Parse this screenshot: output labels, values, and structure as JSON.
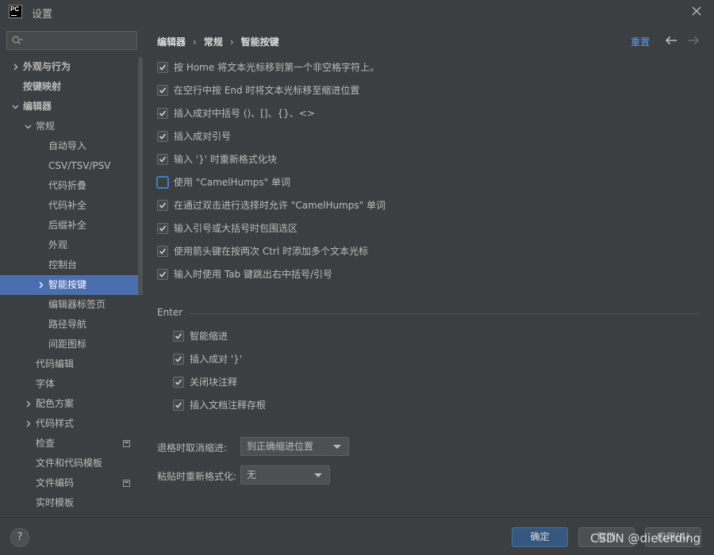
{
  "window": {
    "title": "设置",
    "app_logo_text": "PC",
    "close_icon": "close-icon"
  },
  "sidebar": {
    "search_placeholder": "",
    "search_icon": "search-icon",
    "items": [
      {
        "label": "外观与行为",
        "level": 0,
        "chevron": "right",
        "bold": true
      },
      {
        "label": "按键映射",
        "level": 0,
        "chevron": "none",
        "bold": true
      },
      {
        "label": "编辑器",
        "level": 0,
        "chevron": "down",
        "bold": true
      },
      {
        "label": "常规",
        "level": 1,
        "chevron": "down"
      },
      {
        "label": "自动导入",
        "level": 2
      },
      {
        "label": "CSV/TSV/PSV",
        "level": 2
      },
      {
        "label": "代码折叠",
        "level": 2
      },
      {
        "label": "代码补全",
        "level": 2
      },
      {
        "label": "后缀补全",
        "level": 2
      },
      {
        "label": "外观",
        "level": 2
      },
      {
        "label": "控制台",
        "level": 2
      },
      {
        "label": "智能按键",
        "level": 2,
        "chevron": "right",
        "selected": true
      },
      {
        "label": "编辑器标签页",
        "level": 2
      },
      {
        "label": "路径导航",
        "level": 2
      },
      {
        "label": "间距图标",
        "level": 2
      },
      {
        "label": "代码编辑",
        "level": 1
      },
      {
        "label": "字体",
        "level": 1
      },
      {
        "label": "配色方案",
        "level": 1,
        "chevron": "right"
      },
      {
        "label": "代码样式",
        "level": 1,
        "chevron": "right"
      },
      {
        "label": "检查",
        "level": 1,
        "badge": true
      },
      {
        "label": "文件和代码模板",
        "level": 1
      },
      {
        "label": "文件编码",
        "level": 1,
        "badge": true
      },
      {
        "label": "实时模板",
        "level": 1
      }
    ]
  },
  "breadcrumb": {
    "items": [
      "编辑器",
      "常规",
      "智能按键"
    ],
    "separator": "›"
  },
  "header_actions": {
    "reset_label": "重置",
    "back_icon": "arrow-left-icon",
    "forward_icon": "arrow-right-icon"
  },
  "options": [
    {
      "label": "按 Home 将文本光标移到第一个非空格字符上。",
      "checked": true
    },
    {
      "label": "在空行中按 End 时将文本光标移至缩进位置",
      "checked": true
    },
    {
      "label": "插入成对中括号 ()、[]、{}、<>",
      "checked": true
    },
    {
      "label": "插入成对引号",
      "checked": true
    },
    {
      "label": "输入 '}' 时重新格式化块",
      "checked": true
    },
    {
      "label": "使用 \"CamelHumps\" 单词",
      "checked": false,
      "focused": true
    },
    {
      "label": "在通过双击进行选择时允许 \"CamelHumps\" 单词",
      "checked": true
    },
    {
      "label": "输入引号或大括号时包围选区",
      "checked": true
    },
    {
      "label": "使用箭头键在按两次 Ctrl 时添加多个文本光标",
      "checked": true
    },
    {
      "label": "输入时使用 Tab 键跳出右中括号/引号",
      "checked": true
    }
  ],
  "enter_section": {
    "title": "Enter",
    "options": [
      {
        "label": "智能缩进",
        "checked": true
      },
      {
        "label": "插入成对 '}'",
        "checked": true
      },
      {
        "label": "关闭块注释",
        "checked": true
      },
      {
        "label": "插入文档注释存根",
        "checked": true
      }
    ]
  },
  "fields": {
    "backspace_label": "退格时取消缩进:",
    "backspace_value": "到正确缩进位置",
    "paste_label": "粘贴时重新格式化:",
    "paste_value": "无"
  },
  "footer": {
    "help_label": "?",
    "ok_label": "确定",
    "cancel_label": "取消",
    "apply_label": "应用(A)"
  },
  "watermark": "CSDN @dieterding",
  "colors": {
    "background": "#3c3f41",
    "selection": "#4b6eaf",
    "link": "#589df6",
    "primary_button": "#365880"
  }
}
